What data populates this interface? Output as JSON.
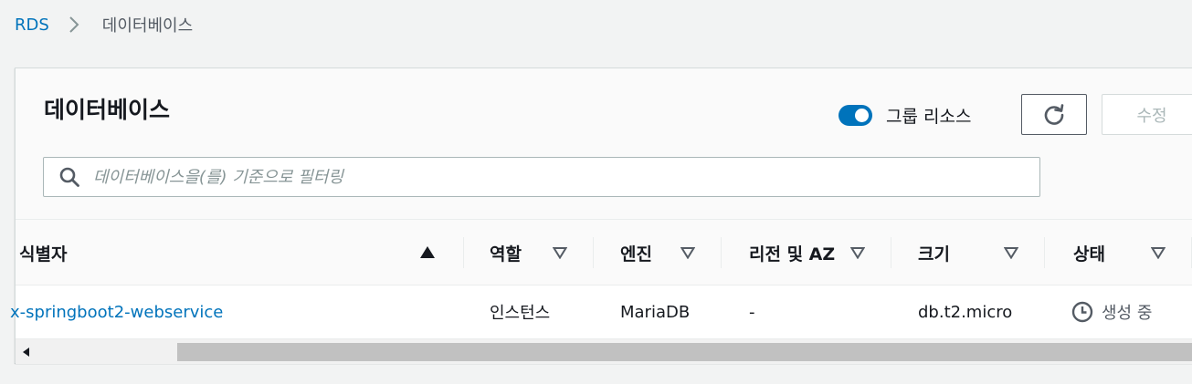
{
  "breadcrumb": {
    "root": "RDS",
    "current": "데이터베이스"
  },
  "panel": {
    "title": "데이터베이스",
    "group_resources_label": "그룹 리소스",
    "group_resources_on": true,
    "edit_label": "수정"
  },
  "search": {
    "placeholder": "데이터베이스을(를) 기준으로 필터링",
    "value": ""
  },
  "table": {
    "columns": [
      {
        "label": "식별자",
        "sort": "ascending"
      },
      {
        "label": "역할",
        "sort": "none"
      },
      {
        "label": "엔진",
        "sort": "none"
      },
      {
        "label": "리전 및 AZ",
        "sort": "none"
      },
      {
        "label": "크기",
        "sort": "none"
      },
      {
        "label": "상태",
        "sort": "none"
      }
    ],
    "rows": [
      {
        "identifier": "x-springboot2-webservice",
        "role": "인스턴스",
        "engine": "MariaDB",
        "region_az": "-",
        "size": "db.t2.micro",
        "status": "생성 중"
      }
    ]
  },
  "colors": {
    "accent": "#0073bb",
    "text": "#16191f",
    "muted": "#545b64",
    "background": "#f2f3f3"
  },
  "icons": {
    "breadcrumb_separator": "chevron-right-icon",
    "refresh": "refresh-icon",
    "search": "search-icon",
    "sort_asc": "sort-ascending-icon",
    "sort_none": "sort-caret-down-icon",
    "status": "clock-icon",
    "scroll_left": "scroll-left-arrow-icon"
  }
}
